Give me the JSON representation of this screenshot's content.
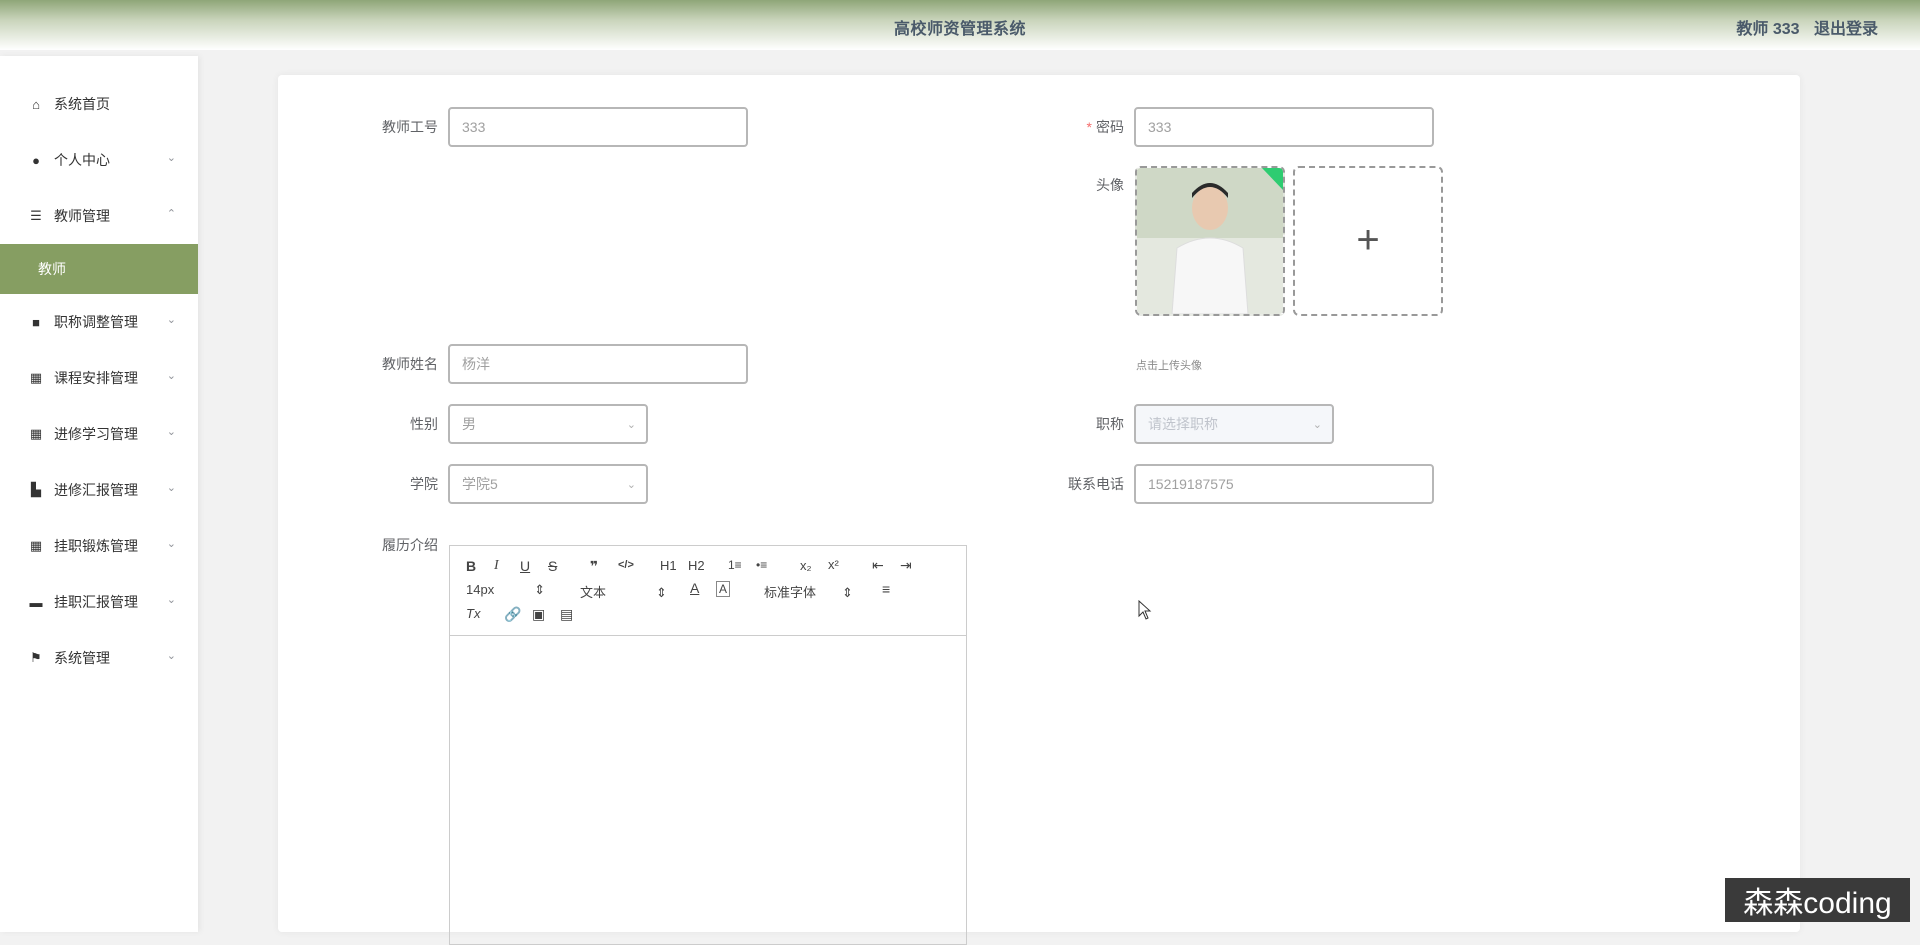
{
  "header": {
    "title": "高校师资管理系统",
    "user_label": "教师 333",
    "logout_label": "退出登录"
  },
  "sidebar": {
    "items": [
      {
        "label": "系统首页",
        "icon": "home-icon"
      },
      {
        "label": "个人中心",
        "icon": "user-icon",
        "arrow": "⌄"
      },
      {
        "label": "教师管理",
        "icon": "sliders-icon",
        "arrow": "⌃"
      },
      {
        "label": "职称调整管理",
        "icon": "briefcase-icon",
        "arrow": "⌄"
      },
      {
        "label": "课程安排管理",
        "icon": "grid-icon",
        "arrow": "⌄"
      },
      {
        "label": "进修学习管理",
        "icon": "grid-icon",
        "arrow": "⌄"
      },
      {
        "label": "进修汇报管理",
        "icon": "stamp-icon",
        "arrow": "⌄"
      },
      {
        "label": "挂职锻炼管理",
        "icon": "grid-icon",
        "arrow": "⌄"
      },
      {
        "label": "挂职汇报管理",
        "icon": "monitor-icon",
        "arrow": "⌄"
      },
      {
        "label": "系统管理",
        "icon": "flag-icon",
        "arrow": "⌄"
      }
    ],
    "active_sub": "教师"
  },
  "form": {
    "teacher_id": {
      "label": "教师工号",
      "value": "333"
    },
    "password": {
      "label": "密码",
      "required_mark": "*",
      "value": "333"
    },
    "avatar": {
      "label": "头像",
      "hint": "点击上传头像",
      "add_glyph": "+"
    },
    "name": {
      "label": "教师姓名",
      "value": "杨洋"
    },
    "gender": {
      "label": "性别",
      "value": "男"
    },
    "title": {
      "label": "职称",
      "placeholder": "请选择职称"
    },
    "college": {
      "label": "学院",
      "value": "学院5"
    },
    "phone": {
      "label": "联系电话",
      "value": "15219187575"
    },
    "resume": {
      "label": "履历介绍"
    }
  },
  "editor": {
    "font_size": "14px",
    "block_type": "文本",
    "font_family": "标准字体",
    "buttons": {
      "bold": "B",
      "italic": "I",
      "underline": "U",
      "strike": "S",
      "quote": "❞",
      "code": "</>",
      "h1": "H1",
      "h2": "H2",
      "ordered_list": "1≡",
      "bullet_list": "•≡",
      "sub": "x₂",
      "sup": "x²",
      "outdent": "⇤",
      "indent": "⇥",
      "font_color": "A",
      "bg_color": "A",
      "align": "≡",
      "clean": "Tx"
    }
  },
  "watermark": "森森coding"
}
